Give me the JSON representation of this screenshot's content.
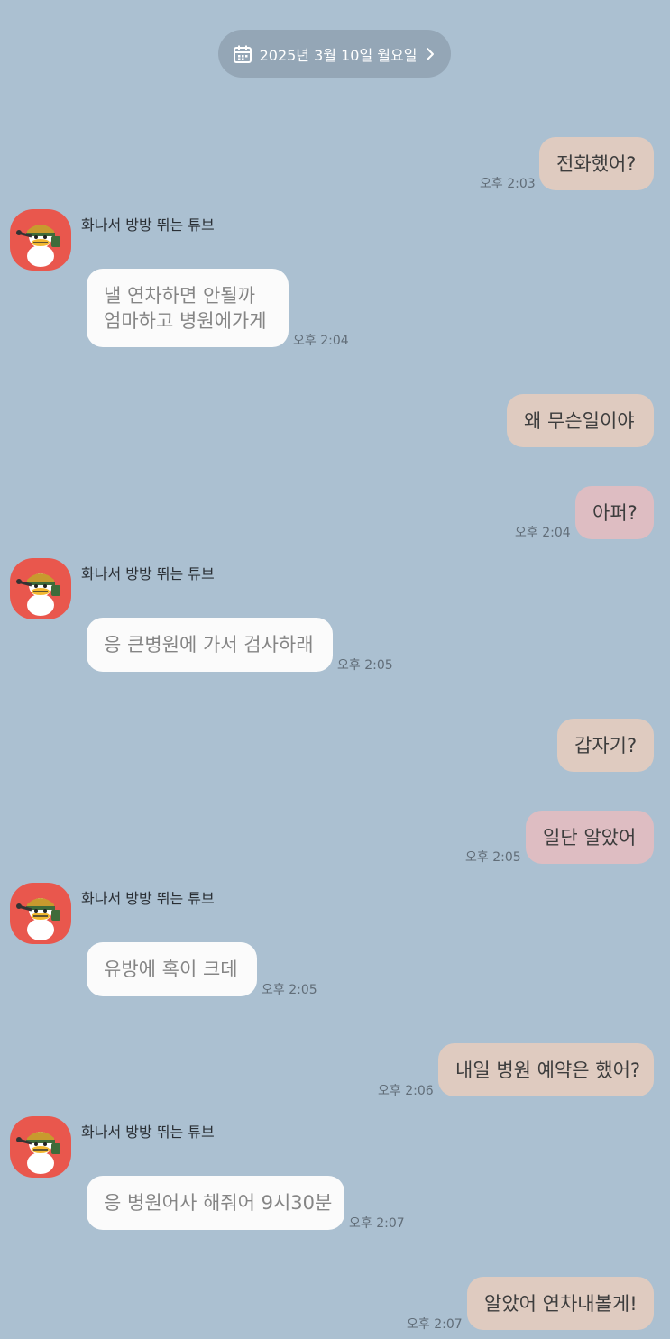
{
  "date_header": {
    "label": "2025년 3월 10일 월요일",
    "icon": "calendar-icon",
    "chevron": "chevron-right-icon"
  },
  "colors": {
    "background": "#abc0d1",
    "my_bubble": "#dfcbc0",
    "my_bubble_pink": "#debdc2",
    "their_bubble": "#fbfbfb",
    "avatar_bg": "#e9574d"
  },
  "contact": {
    "name": "화나서 방방 뛰는 튜브",
    "avatar": "duck-character-avatar"
  },
  "messages": [
    {
      "from": "me",
      "lines": [
        "전화했어?"
      ],
      "time": "오후 2:03"
    },
    {
      "from": "them",
      "sender": "화나서 방방 뛰는 튜브",
      "lines": [
        "낼 연차하면 안될까",
        "엄마하고 병원에가게"
      ],
      "time": "오후 2:04"
    },
    {
      "from": "me",
      "lines": [
        "왜 무슨일이야"
      ],
      "time": ""
    },
    {
      "from": "me",
      "lines": [
        "아퍼?"
      ],
      "time": "오후 2:04"
    },
    {
      "from": "them",
      "sender": "화나서 방방 뛰는 튜브",
      "lines": [
        "응 큰병원에 가서 검사하래"
      ],
      "time": "오후 2:05"
    },
    {
      "from": "me",
      "lines": [
        "갑자기?"
      ],
      "time": ""
    },
    {
      "from": "me",
      "lines": [
        "일단 알았어"
      ],
      "time": "오후 2:05"
    },
    {
      "from": "them",
      "sender": "화나서 방방 뛰는 튜브",
      "lines": [
        "유방에 혹이 크데"
      ],
      "time": "오후 2:05"
    },
    {
      "from": "me",
      "lines": [
        "내일 병원 예약은 했어?"
      ],
      "time": "오후 2:06"
    },
    {
      "from": "them",
      "sender": "화나서 방방 뛰는 튜브",
      "lines": [
        "응 병원어사 해줘어 9시30분"
      ],
      "time": "오후 2:07"
    },
    {
      "from": "me",
      "lines": [
        "알았어 연차내볼게!"
      ],
      "time": "오후 2:07"
    }
  ]
}
